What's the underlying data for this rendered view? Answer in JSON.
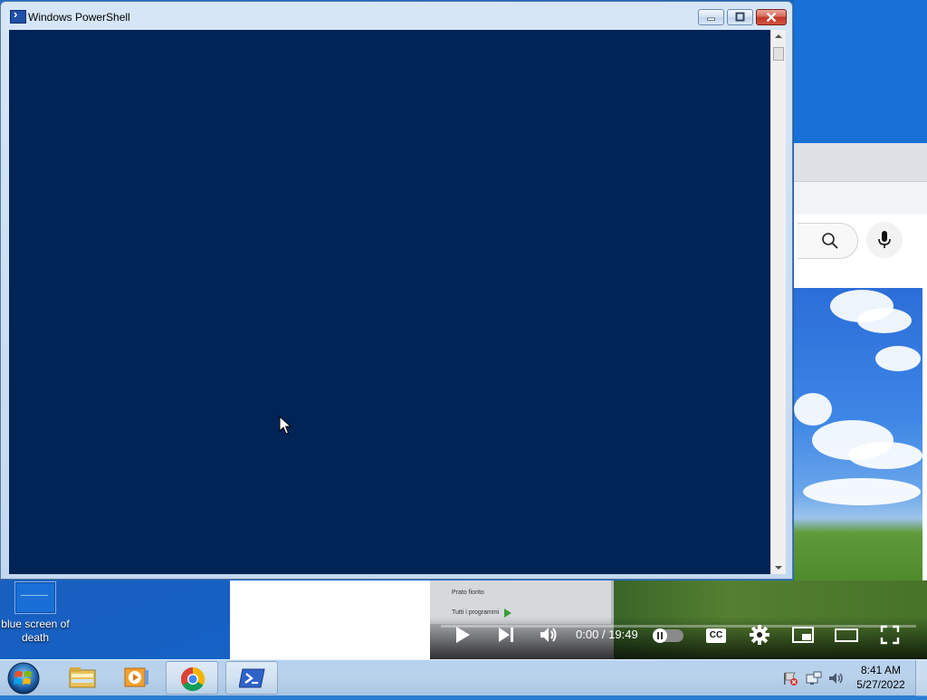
{
  "window": {
    "title": "Windows PowerShell",
    "console_bg": "#012456"
  },
  "desktop": {
    "icons": [
      {
        "label": "blue screen of death"
      }
    ]
  },
  "video_player": {
    "time": "0:00 / 19:49",
    "cc_label": "CC",
    "startmenu_item1": "Prato fiorito",
    "startmenu_item2": "Tutti i programmi"
  },
  "taskbar": {
    "apps": [
      {
        "name": "File Explorer",
        "icon": "folder-icon"
      },
      {
        "name": "Windows Media Player",
        "icon": "media-player-icon"
      },
      {
        "name": "Google Chrome",
        "icon": "chrome-icon"
      },
      {
        "name": "Windows PowerShell",
        "icon": "powershell-icon",
        "active": true
      }
    ],
    "clock_time": "8:41 AM",
    "clock_date": "5/27/2022"
  },
  "colors": {
    "desktop_blue": "#1b5fb8",
    "powershell_blue": "#012456",
    "youtube_player_bg": "#111111"
  }
}
